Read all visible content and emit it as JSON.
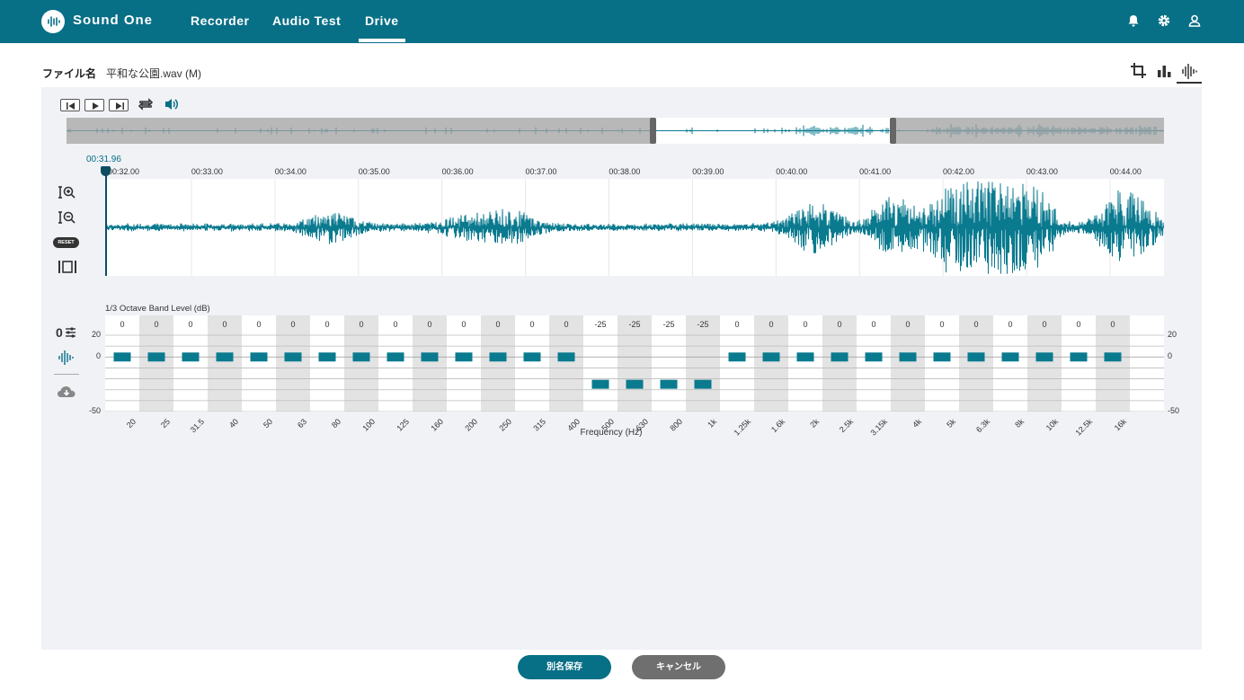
{
  "header": {
    "brand": "Sound One",
    "nav": [
      "Recorder",
      "Audio Test",
      "Drive"
    ],
    "active_nav": "Drive",
    "icons": [
      "bell-icon",
      "gear-icon",
      "user-icon"
    ]
  },
  "file": {
    "label": "ファイル名",
    "name": "平和な公園.wav (M)"
  },
  "view_modes": [
    "crop-icon",
    "bar-chart-icon",
    "waveform-icon"
  ],
  "player": {
    "controls": [
      "skip-start-icon",
      "play-icon",
      "skip-end-icon",
      "repeat-icon",
      "volume-icon"
    ],
    "cursor_time": "00:31.96"
  },
  "timeline": {
    "ticks": [
      "00:32.00",
      "00:33.00",
      "00:34.00",
      "00:35.00",
      "00:36.00",
      "00:37.00",
      "00:38.00",
      "00:39.00",
      "00:40.00",
      "00:41.00",
      "00:42.00",
      "00:43.00",
      "00:44.00"
    ]
  },
  "tools": {
    "reset_label": "RESET"
  },
  "colors": {
    "accent": "#076f86",
    "wave": "#0a7a8f",
    "header": "#076f86",
    "cancel": "#6f6f6f"
  },
  "chart_data": {
    "type": "bar",
    "title": "1/3 Octave Band Level (dB)",
    "xlabel": "Frequency (Hz)",
    "ylim": [
      -50,
      20
    ],
    "yticks": [
      20,
      0,
      -50
    ],
    "categories": [
      "20",
      "25",
      "31.5",
      "40",
      "50",
      "63",
      "80",
      "100",
      "125",
      "160",
      "200",
      "250",
      "315",
      "400",
      "500",
      "630",
      "800",
      "1k",
      "1.25k",
      "1.6k",
      "2k",
      "2.5k",
      "3.15k",
      "4k",
      "5k",
      "6.3k",
      "8k",
      "10k",
      "12.5k",
      "16k"
    ],
    "values": [
      0,
      0,
      0,
      0,
      0,
      0,
      0,
      0,
      0,
      0,
      0,
      0,
      0,
      0,
      -25,
      -25,
      -25,
      -25,
      0,
      0,
      0,
      0,
      0,
      0,
      0,
      0,
      0,
      0,
      0,
      0
    ],
    "value_labels": [
      "0",
      "0",
      "0",
      "0",
      "0",
      "0",
      "0",
      "0",
      "0",
      "0",
      "0",
      "0",
      "0",
      "0",
      "-25",
      "-25",
      "-25",
      "-25",
      "0",
      "0",
      "0",
      "0",
      "0",
      "0",
      "0",
      "0",
      "0",
      "0",
      "0",
      "0"
    ]
  },
  "footer": {
    "save_as": "別名保存",
    "cancel": "キャンセル"
  }
}
